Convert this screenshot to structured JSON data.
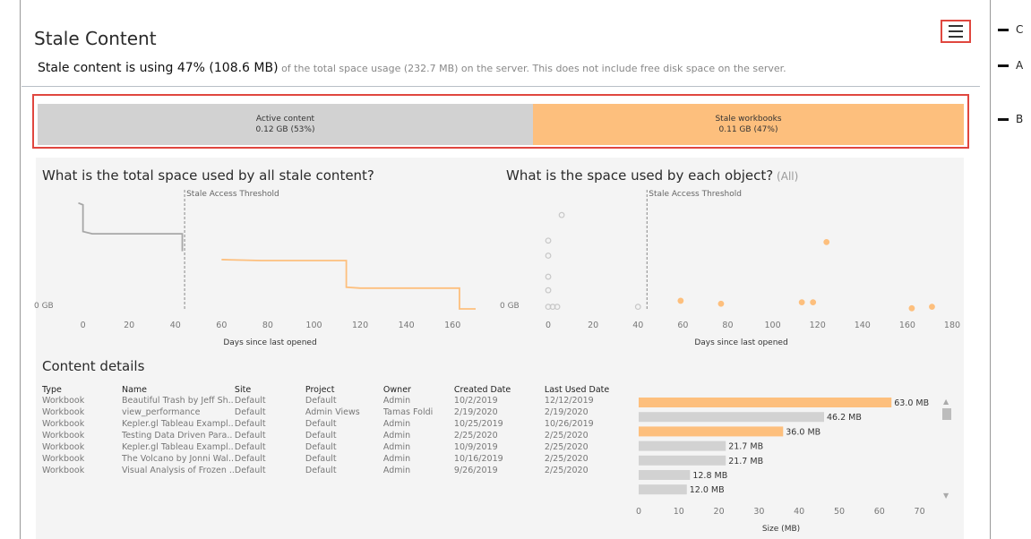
{
  "page": {
    "title": "Stale Content",
    "menu_icon": "hamburger-menu-icon"
  },
  "summary": {
    "lead": "Stale content is using 47% (108.6 MB)",
    "rest": " of the total space usage (232.7 MB) on the server. This does not include free disk space on the server."
  },
  "callouts": {
    "c": "C",
    "a": "A",
    "b": "B"
  },
  "space_bar": {
    "active": {
      "label": "Active content",
      "value": "0.12 GB (53%)",
      "share": 0.53
    },
    "stale": {
      "label": "Stale workbooks",
      "value": "0.11 GB (47%)",
      "share": 0.47
    }
  },
  "colors": {
    "stale": "#fdbf7d",
    "active": "#d2d2d2",
    "callout_border": "#e0473f"
  },
  "chart_titles": {
    "total": "What is the total space used by all stale content?",
    "object": "What is the space used by each object?",
    "object_filter": " (All)"
  },
  "chart_data": [
    {
      "type": "line",
      "title": "What is the total space used by all stale content?",
      "xlabel": "Days since last opened",
      "ylabel": "",
      "y_tick_labels": [
        "0 GB"
      ],
      "xlim": [
        -8,
        170
      ],
      "x_ticks": [
        0,
        20,
        40,
        60,
        80,
        100,
        120,
        140,
        160
      ],
      "reference_line": {
        "x": 44,
        "label": "Stale Access Threshold"
      },
      "series": [
        {
          "color": "#a7a7a7",
          "points": [
            [
              -2,
              0.232
            ],
            [
              0,
              0.228
            ],
            [
              0,
              0.17
            ],
            [
              4,
              0.165
            ],
            [
              43,
              0.165
            ],
            [
              43,
              0.127
            ]
          ]
        },
        {
          "color": "#fdbf7d",
          "points": [
            [
              60,
              0.109
            ],
            [
              77,
              0.107
            ],
            [
              114,
              0.107
            ],
            [
              114,
              0.049
            ],
            [
              120,
              0.047
            ],
            [
              163,
              0.047
            ],
            [
              163,
              0.002
            ],
            [
              170,
              0.002
            ]
          ]
        }
      ]
    },
    {
      "type": "scatter",
      "title": "What is the space used by each object? (All)",
      "xlabel": "Days since last opened",
      "ylabel": "",
      "y_tick_labels": [
        "0 GB"
      ],
      "xlim": [
        -8,
        180
      ],
      "x_ticks": [
        0,
        20,
        40,
        60,
        80,
        100,
        120,
        140,
        160,
        180
      ],
      "reference_line": {
        "x": 44,
        "label": "Stale Access Threshold"
      },
      "series": [
        {
          "name": "",
          "color": "#c7c7c7",
          "filled": false,
          "points": [
            [
              6,
              0.063
            ],
            [
              0,
              0.046
            ],
            [
              0,
              0.036
            ],
            [
              0,
              0.022
            ],
            [
              0,
              0.013
            ],
            [
              0,
              0.002
            ],
            [
              2,
              0.002
            ],
            [
              4,
              0.002
            ],
            [
              40,
              0.002
            ]
          ]
        },
        {
          "name": "",
          "color": "#fdbf7d",
          "filled": true,
          "points": [
            [
              124,
              0.045
            ],
            [
              59,
              0.006
            ],
            [
              77,
              0.004
            ],
            [
              113,
              0.005
            ],
            [
              118,
              0.005
            ],
            [
              162,
              0.001
            ],
            [
              171,
              0.002
            ]
          ]
        }
      ]
    },
    {
      "type": "bar",
      "title": "",
      "xlabel": "Size (MB)",
      "xlim": [
        0,
        76
      ],
      "x_ticks": [
        0,
        10,
        20,
        30,
        40,
        50,
        60,
        70
      ],
      "categories": [
        "Beautiful Trash by Jeff Sh..",
        "view_performance",
        "Kepler.gl Tableau Exampl..",
        "Testing Data Driven Para..",
        "Kepler.gl Tableau Exampl..",
        "The Volcano by Jonni Wal..",
        "Visual Analysis of Frozen .."
      ],
      "values": [
        63.0,
        46.2,
        36.0,
        21.7,
        21.7,
        12.8,
        12.0
      ],
      "labels": [
        "63.0 MB",
        "46.2 MB",
        "36.0 MB",
        "21.7 MB",
        "21.7 MB",
        "12.8 MB",
        "12.0 MB"
      ],
      "stale": [
        true,
        false,
        true,
        false,
        false,
        false,
        false
      ]
    }
  ],
  "details": {
    "title": "Content details",
    "columns": [
      "Type",
      "Name",
      "Site",
      "Project",
      "Owner",
      "Created Date",
      "Last Used Date"
    ],
    "rows": [
      [
        "Workbook",
        "Beautiful Trash by Jeff Sh..",
        "Default",
        "Default",
        "Admin",
        "10/2/2019",
        "12/12/2019"
      ],
      [
        "Workbook",
        "view_performance",
        "Default",
        "Admin Views",
        "Tamas Foldi",
        "2/19/2020",
        "2/19/2020"
      ],
      [
        "Workbook",
        "Kepler.gl Tableau Exampl..",
        "Default",
        "Default",
        "Admin",
        "10/25/2019",
        "10/26/2019"
      ],
      [
        "Workbook",
        "Testing Data Driven Para..",
        "Default",
        "Default",
        "Admin",
        "2/25/2020",
        "2/25/2020"
      ],
      [
        "Workbook",
        "Kepler.gl Tableau Exampl..",
        "Default",
        "Default",
        "Admin",
        "10/9/2019",
        "2/25/2020"
      ],
      [
        "Workbook",
        "The Volcano by Jonni Wal..",
        "Default",
        "Default",
        "Admin",
        "10/16/2019",
        "2/25/2020"
      ],
      [
        "Workbook",
        "Visual Analysis of Frozen ..",
        "Default",
        "Default",
        "Admin",
        "9/26/2019",
        "2/25/2020"
      ]
    ]
  },
  "scrollbar": {
    "up": "▲",
    "down": "▼"
  }
}
